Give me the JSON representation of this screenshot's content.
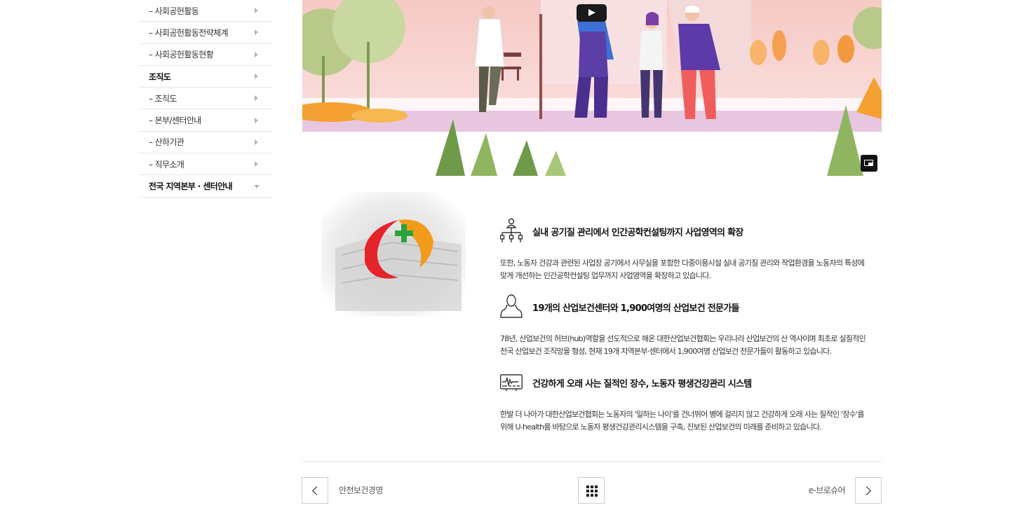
{
  "sidebar": {
    "items": [
      {
        "label": "– 사회공헌활동",
        "level": "sub"
      },
      {
        "label": "– 사회공헌활동전략체계",
        "level": "sub"
      },
      {
        "label": "– 사회공헌활동현황",
        "level": "sub"
      },
      {
        "label": "조직도",
        "level": "top"
      },
      {
        "label": "– 조직도",
        "level": "sub"
      },
      {
        "label": "– 본부/센터안내",
        "level": "sub"
      },
      {
        "label": "– 산하기관",
        "level": "sub"
      },
      {
        "label": "– 직무소개",
        "level": "sub"
      },
      {
        "label": "전국 지역본부 · 센터안내",
        "level": "top"
      }
    ]
  },
  "video": {
    "play_icon": "play-icon",
    "pip_icon": "picture-in-picture-icon"
  },
  "features": [
    {
      "icon": "organization-chart-icon",
      "title": "실내 공기질 관리에서 인간공학컨설팅까지 사업영역의 확장",
      "desc_line1": "또한, 노동자 건강과 관련된 사업장 공기에서 사무실을 포함한 다중이용시설 실내 공기질 관리와 작업환경을 노동자의 특성에",
      "desc_line2": "맞게 개선하는 인간공학컨설팅 업무까지 사업영역을 확장하고 있습니다."
    },
    {
      "icon": "person-icon",
      "title": "19개의 산업보건센터와 1,900여명의 산업보건 전문가들",
      "desc_line1": "78년, 산업보건의 허브(hub)역할을 선도적으로 해온 대한산업보건협회는 우리나라 산업보건의 산 역사이며 최초로 실질적인",
      "desc_line2": "전국 산업보건 조직망을 형성, 현재 19개 지역본부·센터에서 1,900여명 산업보건 전문가들이 활동하고 있습니다."
    },
    {
      "icon": "health-monitor-icon",
      "title": "건강하게 오래 사는 질적인 장수, 노동자 평생건강관리 시스템",
      "desc_line1": "한발 더 나아가 대한산업보건협회는 노동자의 '일하는 나이'를 건너뛰어 병에 걸리지 않고 건강하게 오래 사는 질적인 '장수'를",
      "desc_line2": "위해 U-health를 바탕으로 노동자 평생건강관리시스템을 구축, 진보된 산업보건의 미래를 준비하고 있습니다."
    }
  ],
  "pagination": {
    "prev_label": "안전보건경영",
    "next_label": "e-브로슈어"
  }
}
